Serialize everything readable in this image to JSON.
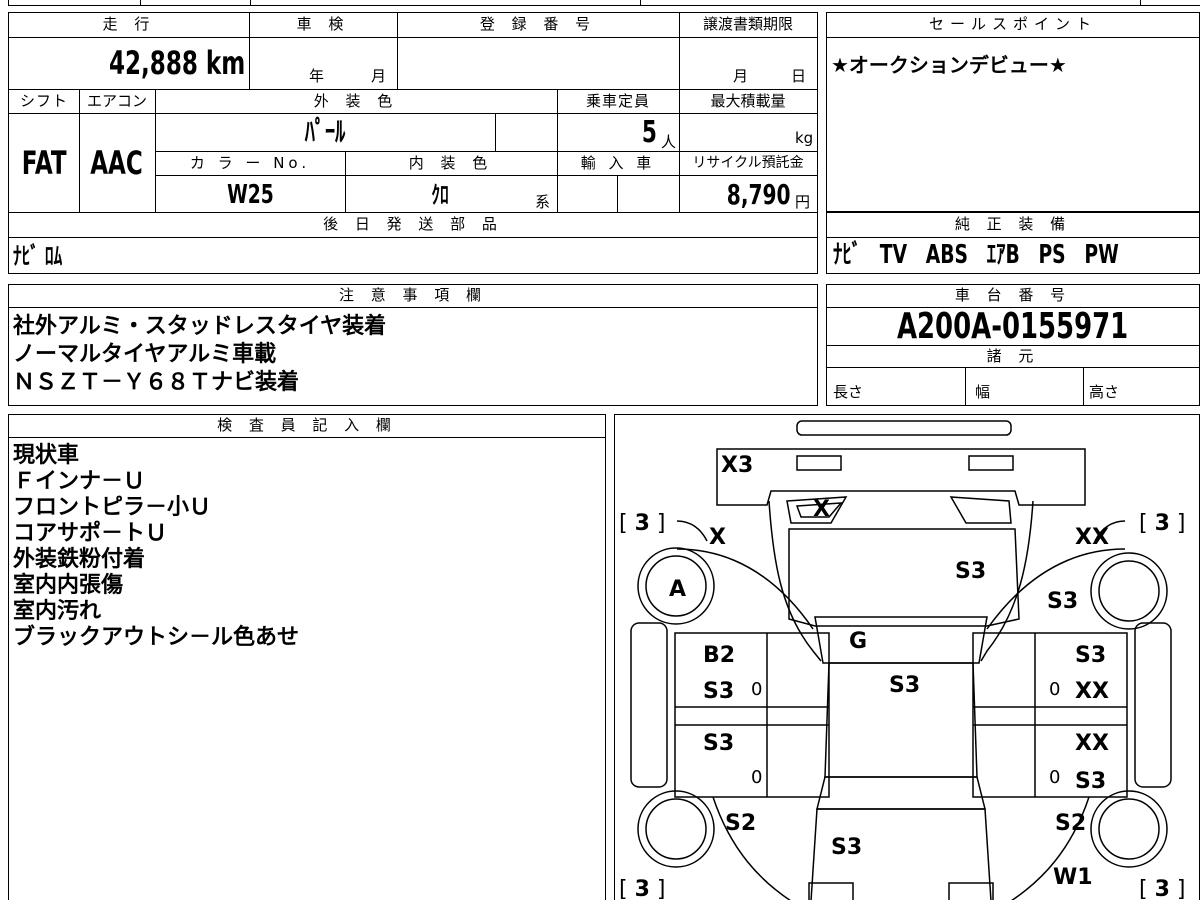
{
  "vehicle": {
    "mileage_label": "走 行",
    "mileage_value": "42,888 km",
    "inspection_label": "車 検",
    "inspection_year": "年",
    "inspection_month": "月",
    "registration_label": "登 録 番 号",
    "transfer_label": "譲渡書類期限",
    "transfer_month": "月",
    "transfer_day": "日",
    "shift_label": "シフト",
    "shift_value": "FAT",
    "ac_label": "エアコン",
    "ac_value": "AAC",
    "exterior_color_label": "外 装 色",
    "exterior_color_value": "ﾊﾟｰﾙ",
    "capacity_label": "乗車定員",
    "capacity_value": "5",
    "capacity_unit": "人",
    "max_load_label": "最大積載量",
    "max_load_unit": "kg",
    "color_no_label": "カ ラ ー No.",
    "color_no_value": "W25",
    "interior_color_label": "内 装 色",
    "interior_color_value": "ｸﾛ",
    "interior_color_suffix": "系",
    "import_label": "輸 入 車",
    "recycle_label": "リサイクル預託金",
    "recycle_value": "8,790",
    "recycle_unit": "円",
    "later_parts_label": "後 日 発 送 部 品",
    "later_parts_value": "ﾅﾋﾞ ﾛﾑ"
  },
  "sales_point": {
    "label": "セールスポイント",
    "text": "★オークションデビュー★"
  },
  "genuine_equipment": {
    "label": "純 正 装 備",
    "value": "ﾅﾋﾞ　TV　ABS　ｴｱB　PS　PW"
  },
  "notes": {
    "label": "注 意 事 項 欄",
    "lines": [
      "社外アルミ・スタッドレスタイヤ装着",
      "ノーマルタイヤアルミ車載",
      "ＮＳＺＴ－Ｙ６８Ｔナビ装着"
    ]
  },
  "chassis": {
    "label": "車 台 番 号",
    "value": "A200A-0155971",
    "specs_label": "諸 元",
    "length_label": "長さ",
    "width_label": "幅",
    "height_label": "高さ"
  },
  "inspector": {
    "label": "検 査 員 記 入 欄",
    "lines": [
      "現状車",
      "Ｆインナ－Ｕ",
      "フロントピラ－小Ｕ",
      "コアサポ－トＵ",
      "外装鉄粉付着",
      "室内内張傷",
      "室内汚れ",
      "ブラックアウトシ－ル色あせ"
    ]
  },
  "diagram": {
    "marks": {
      "front_bumper": "X3",
      "windshield_top": "X",
      "front_left_fender": "X",
      "front_right_fender": "XX",
      "hood": "S3",
      "right_fender_rear": "S3",
      "left_front_wheel": "A",
      "windshield": "G",
      "left_front_door_1": "B2",
      "left_front_door_2": "S3",
      "roof": "S3",
      "right_front_door_1": "S3",
      "right_front_door_2": "XX",
      "left_rear_door": "S3",
      "right_rear_door_1": "XX",
      "right_rear_door_2": "S3",
      "left_rear_quarter": "S2",
      "right_rear_quarter": "S2",
      "trunk": "S3",
      "rear_right": "W1"
    },
    "tire_tread": {
      "front_left": "3",
      "front_right": "3",
      "rear_left": "3",
      "rear_right": "3"
    },
    "zero_marks": [
      "0",
      "0",
      "0",
      "0"
    ]
  },
  "colors": {
    "line": "#000000",
    "background": "#ffffff"
  }
}
